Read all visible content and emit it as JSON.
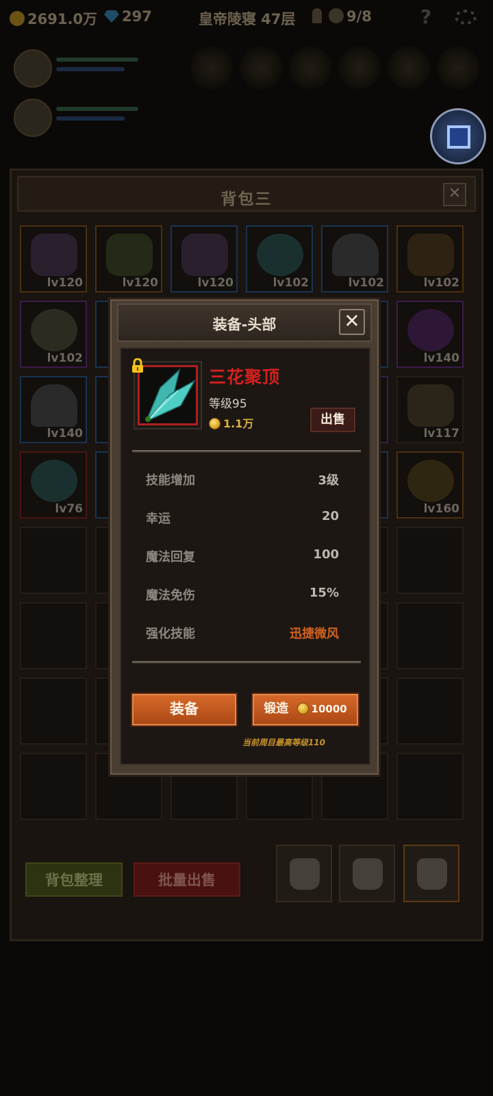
{
  "topbar": {
    "gold": "2691.0万",
    "gems": "297",
    "location": "皇帝陵寝 47层",
    "keys": "9/8",
    "help_icon": "question-mark-icon",
    "settings_icon": "gears-icon"
  },
  "bag": {
    "title": "背包三",
    "close_label": "✕",
    "cells": [
      {
        "level": "lv120",
        "rarity": "orange",
        "icon": "armor-icon"
      },
      {
        "level": "lv120",
        "rarity": "orange",
        "icon": "gun-icon"
      },
      {
        "level": "lv120",
        "rarity": "blue",
        "icon": "armor-icon"
      },
      {
        "level": "lv102",
        "rarity": "blue",
        "icon": "net-helmet-icon"
      },
      {
        "level": "lv102",
        "rarity": "blue",
        "icon": "helmet-icon"
      },
      {
        "level": "lv102",
        "rarity": "orange",
        "icon": "wing-icon"
      },
      {
        "level": "lv102",
        "rarity": "purple",
        "icon": "ring-icon"
      },
      {
        "level": "lv140",
        "rarity": "purple",
        "icon": "amulet-icon"
      },
      {
        "level": "lv140",
        "rarity": "blue",
        "icon": "helmet-icon"
      },
      {
        "level": "lv117",
        "rarity": "none",
        "icon": "feather-icon"
      },
      {
        "level": "lv76",
        "rarity": "red",
        "icon": "net-helmet-icon"
      },
      {
        "level": "lv160",
        "rarity": "orange",
        "icon": "necklace-icon"
      }
    ],
    "sort_label": "背包整理",
    "bulk_sell_label": "批量出售"
  },
  "popup": {
    "title": "装备-头部",
    "close_label": "✕",
    "item": {
      "name": "三花聚顶",
      "level_text": "等级95",
      "price": "1.1万",
      "locked": true,
      "icon": "crystal-wing-icon"
    },
    "sell_label": "出售",
    "stats": [
      {
        "name": "技能增加",
        "value": "3级"
      },
      {
        "name": "幸运",
        "value": "20"
      },
      {
        "name": "魔法回复",
        "value": "100"
      },
      {
        "name": "魔法免伤",
        "value": "15%"
      },
      {
        "name": "强化技能",
        "value": "迅捷微风"
      }
    ],
    "equip_label": "装备",
    "forge_label": "锻造",
    "forge_cost": "10000",
    "max_level_note": "当前周目最高等级110"
  },
  "colors": {
    "item_name": "#d42020",
    "skill_value": "#d2621e",
    "button_orange": "#c45a20",
    "price_gold": "#d8b046"
  }
}
